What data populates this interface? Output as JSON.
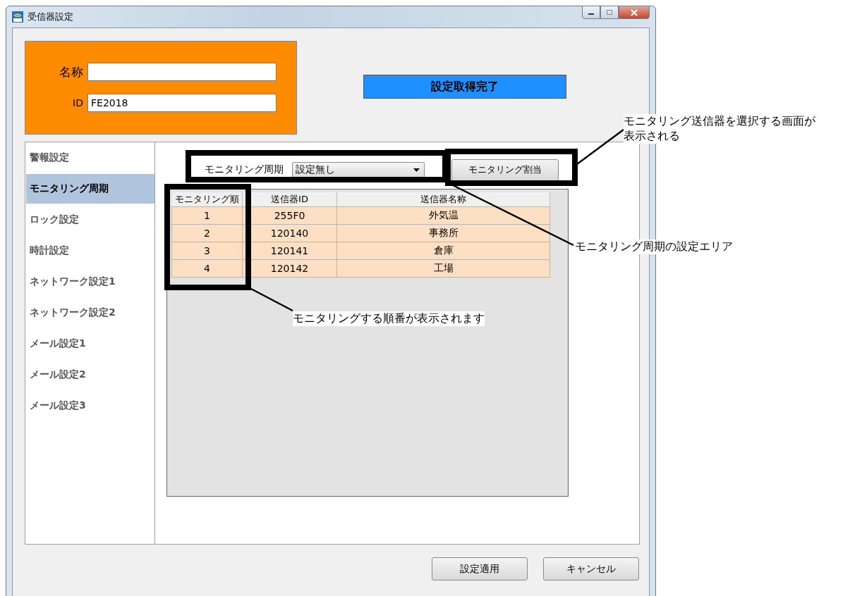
{
  "window": {
    "title": "受信器設定"
  },
  "header": {
    "name_label": "名称",
    "id_label": "ID",
    "id_value": "FE2018",
    "status": "設定取得完了"
  },
  "sidebar": {
    "items": [
      {
        "label": "警報設定",
        "selected": false
      },
      {
        "label": "モニタリング周期",
        "selected": true
      },
      {
        "label": "ロック設定",
        "selected": false
      },
      {
        "label": "時計設定",
        "selected": false
      },
      {
        "label": "ネットワーク設定1",
        "selected": false
      },
      {
        "label": "ネットワーク設定2",
        "selected": false
      },
      {
        "label": "メール設定1",
        "selected": false
      },
      {
        "label": "メール設定2",
        "selected": false
      },
      {
        "label": "メール設定3",
        "selected": false
      }
    ]
  },
  "monitoring": {
    "cycle_label": "モニタリング周期",
    "cycle_value": "設定無し",
    "assign_button": "モニタリング割当"
  },
  "table": {
    "columns": [
      "モニタリング順",
      "送信器ID",
      "送信器名称"
    ],
    "rows": [
      [
        "1",
        "255F0",
        "外気温"
      ],
      [
        "2",
        "120140",
        "事務所"
      ],
      [
        "3",
        "120141",
        "倉庫"
      ],
      [
        "4",
        "120142",
        "工場"
      ]
    ]
  },
  "buttons": [
    "設定適用",
    "キャンセル"
  ],
  "annotations": [
    {
      "lines": [
        "モニタリング送信器を選択する画面が",
        "表示される"
      ]
    },
    {
      "lines": [
        "モニタリング周期の設定エリア"
      ]
    },
    {
      "lines": [
        "モニタリングする順番が表示されます"
      ]
    }
  ]
}
